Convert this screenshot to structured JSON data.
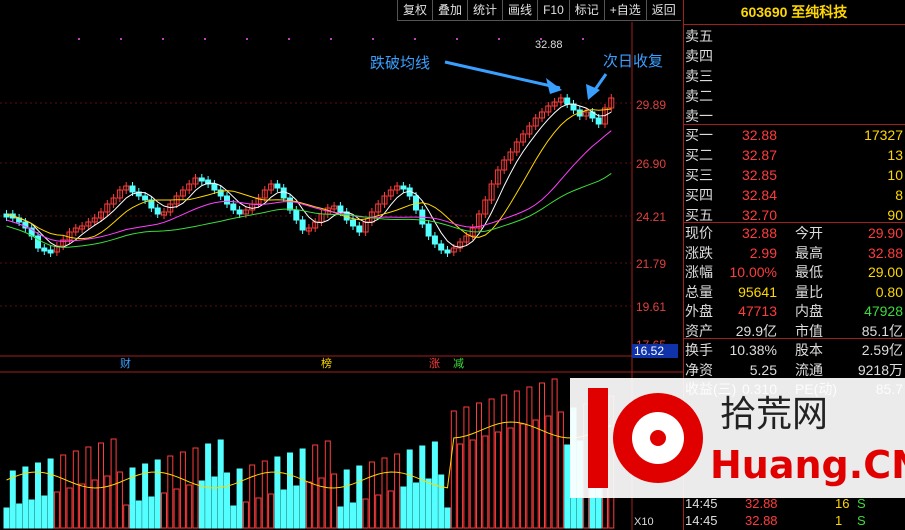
{
  "toolbar": [
    "复权",
    "叠加",
    "统计",
    "画线",
    "F10",
    "标记",
    "+自选",
    "返回"
  ],
  "price_axis": [
    "29.89",
    "26.90",
    "24.21",
    "21.79",
    "19.61",
    "17.65"
  ],
  "current_price_tag": "16.52",
  "high_label": "32.88",
  "annotations": {
    "break": "跌破均线",
    "recover": "次日收复"
  },
  "markers": [
    {
      "text": "财",
      "color": "#3aa0ff"
    },
    {
      "text": "榜",
      "color": "#ffd700"
    },
    {
      "text": "涨",
      "color": "#ff3c3c"
    },
    {
      "text": "减",
      "color": "#3cdc3c"
    }
  ],
  "volume_scale": "X10",
  "stock": {
    "code": "603690",
    "name": "至纯科技"
  },
  "order_book": {
    "asks": [
      {
        "label": "卖五",
        "price": "",
        "vol": ""
      },
      {
        "label": "卖四",
        "price": "",
        "vol": ""
      },
      {
        "label": "卖三",
        "price": "",
        "vol": ""
      },
      {
        "label": "卖二",
        "price": "",
        "vol": ""
      },
      {
        "label": "卖一",
        "price": "",
        "vol": ""
      }
    ],
    "bids": [
      {
        "label": "买一",
        "price": "32.88",
        "vol": "17327"
      },
      {
        "label": "买二",
        "price": "32.87",
        "vol": "13"
      },
      {
        "label": "买三",
        "price": "32.85",
        "vol": "10"
      },
      {
        "label": "买四",
        "price": "32.84",
        "vol": "8"
      },
      {
        "label": "买五",
        "price": "32.70",
        "vol": "90"
      }
    ]
  },
  "quote": [
    {
      "l1": "现价",
      "v1": "32.88",
      "c1": "red",
      "l2": "今开",
      "v2": "29.90",
      "c2": "red"
    },
    {
      "l1": "涨跌",
      "v1": "2.99",
      "c1": "red",
      "l2": "最高",
      "v2": "32.88",
      "c2": "red"
    },
    {
      "l1": "涨幅",
      "v1": "10.00%",
      "c1": "red",
      "l2": "最低",
      "v2": "29.00",
      "c2": "yel"
    },
    {
      "l1": "总量",
      "v1": "95641",
      "c1": "yel",
      "l2": "量比",
      "v2": "0.80",
      "c2": "yel"
    },
    {
      "l1": "外盘",
      "v1": "47713",
      "c1": "red",
      "l2": "内盘",
      "v2": "47928",
      "c2": "grn"
    },
    {
      "l1": "资产",
      "v1": "29.9亿",
      "c1": "white",
      "l2": "市值",
      "v2": "85.1亿",
      "c2": "white"
    },
    {
      "l1": "换手",
      "v1": "10.38%",
      "c1": "white",
      "l2": "股本",
      "v2": "2.59亿",
      "c2": "white"
    },
    {
      "l1": "净资",
      "v1": "5.25",
      "c1": "white",
      "l2": "流通",
      "v2": "9218万",
      "c2": "white"
    },
    {
      "l1": "收益(三)",
      "v1": "0.310",
      "c1": "white",
      "l2": "PE(动)",
      "v2": "85.7",
      "c2": "white"
    }
  ],
  "ticks": [
    {
      "time": "14:45",
      "price": "32.88",
      "vol": "16",
      "side": "S"
    },
    {
      "time": "14:45",
      "price": "32.88",
      "vol": "1",
      "side": "S"
    }
  ],
  "watermark": {
    "digits": "10",
    "cn": "拾荒网",
    "en": "Huang.CN"
  }
}
